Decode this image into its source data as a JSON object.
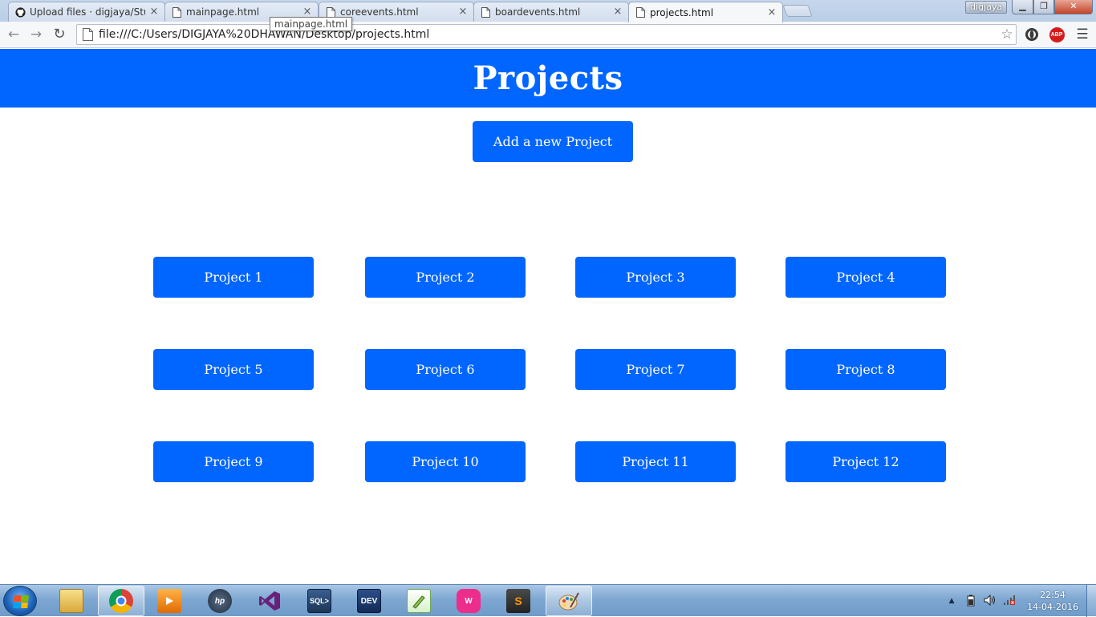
{
  "browser": {
    "tabs": [
      {
        "title": "Upload files · digjaya/Stud",
        "icon": "github-icon",
        "active": false
      },
      {
        "title": "mainpage.html",
        "icon": "page-icon",
        "active": false
      },
      {
        "title": "coreevents.html",
        "icon": "page-icon",
        "active": false
      },
      {
        "title": "boardevents.html",
        "icon": "page-icon",
        "active": false
      },
      {
        "title": "projects.html",
        "icon": "page-icon",
        "active": true
      }
    ],
    "tooltip": "mainpage.html",
    "profile_name": "digjaya",
    "url": "file:///C:/Users/DIGJAYA%20DHAWAN/Desktop/projects.html",
    "extension_abp": "ABP",
    "close_glyph": "×",
    "back_glyph": "←",
    "forward_glyph": "→",
    "reload_glyph": "↻",
    "star_glyph": "☆",
    "menu_glyph": "☰",
    "minimize_glyph": "▁",
    "maximize_glyph": "❐",
    "window_close_glyph": "✕"
  },
  "page": {
    "title": "Projects",
    "add_button": "Add a new Project",
    "projects": [
      "Project 1",
      "Project 2",
      "Project 3",
      "Project 4",
      "Project 5",
      "Project 6",
      "Project 7",
      "Project 8",
      "Project 9",
      "Project 10",
      "Project 11",
      "Project 12"
    ],
    "accent_color": "#0066ff"
  },
  "taskbar": {
    "apps": [
      {
        "name": "file-explorer-icon",
        "active": false
      },
      {
        "name": "chrome-icon",
        "active": true
      },
      {
        "name": "media-player-icon",
        "active": false
      },
      {
        "name": "hp-icon",
        "active": false
      },
      {
        "name": "visual-studio-icon",
        "active": false
      },
      {
        "name": "sql-icon",
        "active": false,
        "label": "SQL>"
      },
      {
        "name": "dev-cpp-icon",
        "active": false,
        "label": "DEV"
      },
      {
        "name": "notepad-plus-plus-icon",
        "active": false
      },
      {
        "name": "wamp-icon",
        "active": false
      },
      {
        "name": "sublime-text-icon",
        "active": false,
        "label": "S"
      },
      {
        "name": "paint-icon",
        "active": false
      }
    ],
    "tray_expand_glyph": "▲",
    "clock_time": "22:54",
    "clock_date": "14-04-2016"
  }
}
